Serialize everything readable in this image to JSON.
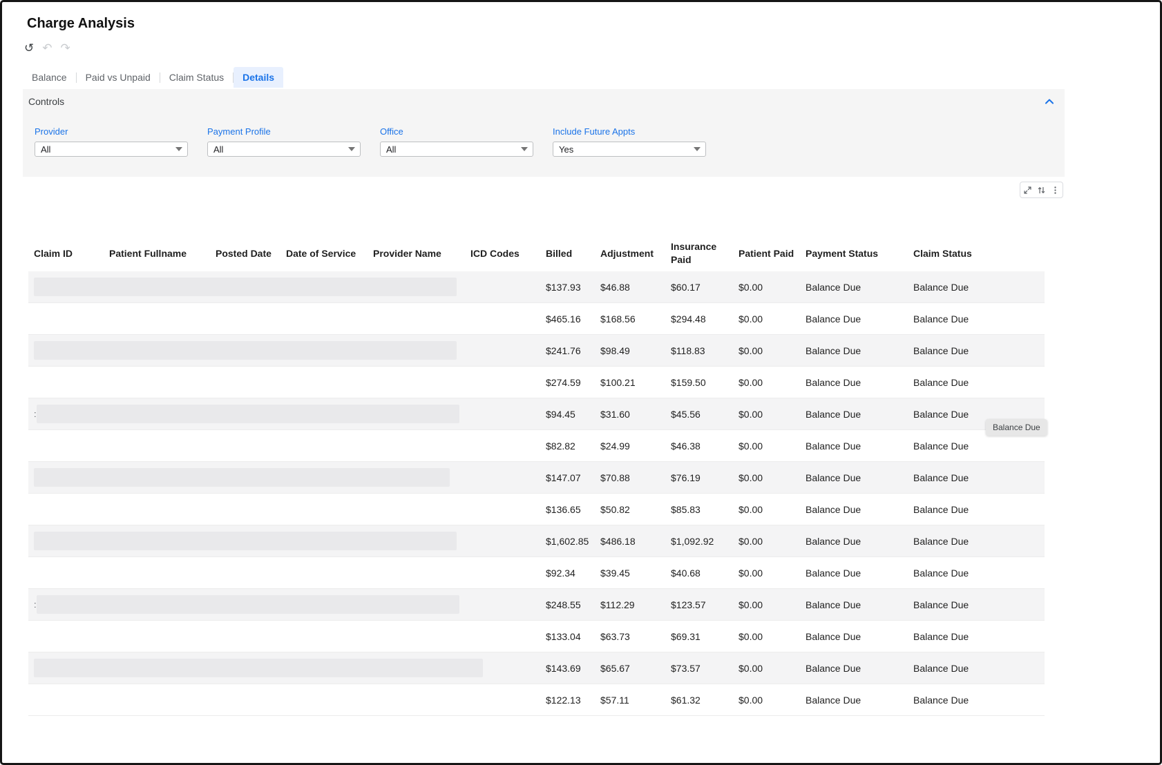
{
  "page": {
    "title": "Charge Analysis"
  },
  "colors": {
    "accent": "#1a73e8",
    "active_tab_bg": "#e8f0fe",
    "stripe": "#f4f4f5"
  },
  "history": {
    "reset_icon": "↺",
    "undo_icon": "↶",
    "redo_icon": "↷"
  },
  "tabs": [
    {
      "label": "Balance",
      "active": false
    },
    {
      "label": "Paid vs Unpaid",
      "active": false
    },
    {
      "label": "Claim Status",
      "active": false
    },
    {
      "label": "Details",
      "active": true
    }
  ],
  "controls": {
    "title": "Controls",
    "filters": [
      {
        "label": "Provider",
        "value": "All"
      },
      {
        "label": "Payment Profile",
        "value": "All"
      },
      {
        "label": "Office",
        "value": "All"
      },
      {
        "label": "Include Future Appts",
        "value": "Yes"
      }
    ]
  },
  "grid_toolbar": {
    "icons": [
      "expand-icon",
      "sort-icon",
      "kebab-menu-icon"
    ]
  },
  "tooltip": {
    "text": "Balance Due"
  },
  "table": {
    "columns": [
      "Claim ID",
      "Patient Fullname",
      "Posted Date",
      "Date of Service",
      "Provider Name",
      "ICD Codes",
      "Billed",
      "Adjustment",
      "Insurance Paid",
      "Patient Paid",
      "Payment Status",
      "Claim Status"
    ],
    "rows": [
      {
        "billed": "$137.93",
        "adjustment": "$46.88",
        "insurance_paid": "$60.17",
        "patient_paid": "$0.00",
        "payment_status": "Balance Due",
        "claim_status": "Balance Due"
      },
      {
        "billed": "$465.16",
        "adjustment": "$168.56",
        "insurance_paid": "$294.48",
        "patient_paid": "$0.00",
        "payment_status": "Balance Due",
        "claim_status": "Balance Due"
      },
      {
        "billed": "$241.76",
        "adjustment": "$98.49",
        "insurance_paid": "$118.83",
        "patient_paid": "$0.00",
        "payment_status": "Balance Due",
        "claim_status": "Balance Due"
      },
      {
        "billed": "$274.59",
        "adjustment": "$100.21",
        "insurance_paid": "$159.50",
        "patient_paid": "$0.00",
        "payment_status": "Balance Due",
        "claim_status": "Balance Due"
      },
      {
        "prefix": ":",
        "billed": "$94.45",
        "adjustment": "$31.60",
        "insurance_paid": "$45.56",
        "patient_paid": "$0.00",
        "payment_status": "Balance Due",
        "claim_status": "Balance Due"
      },
      {
        "billed": "$82.82",
        "adjustment": "$24.99",
        "insurance_paid": "$46.38",
        "patient_paid": "$0.00",
        "payment_status": "Balance Due",
        "claim_status": "Balance Due"
      },
      {
        "billed": "$147.07",
        "adjustment": "$70.88",
        "insurance_paid": "$76.19",
        "patient_paid": "$0.00",
        "payment_status": "Balance Due",
        "claim_status": "Balance Due"
      },
      {
        "billed": "$136.65",
        "adjustment": "$50.82",
        "insurance_paid": "$85.83",
        "patient_paid": "$0.00",
        "payment_status": "Balance Due",
        "claim_status": "Balance Due"
      },
      {
        "billed": "$1,602.85",
        "adjustment": "$486.18",
        "insurance_paid": "$1,092.92",
        "patient_paid": "$0.00",
        "payment_status": "Balance Due",
        "claim_status": "Balance Due"
      },
      {
        "billed": "$92.34",
        "adjustment": "$39.45",
        "insurance_paid": "$40.68",
        "patient_paid": "$0.00",
        "payment_status": "Balance Due",
        "claim_status": "Balance Due"
      },
      {
        "prefix": ":",
        "billed": "$248.55",
        "adjustment": "$112.29",
        "insurance_paid": "$123.57",
        "patient_paid": "$0.00",
        "payment_status": "Balance Due",
        "claim_status": "Balance Due"
      },
      {
        "billed": "$133.04",
        "adjustment": "$63.73",
        "insurance_paid": "$69.31",
        "patient_paid": "$0.00",
        "payment_status": "Balance Due",
        "claim_status": "Balance Due"
      },
      {
        "billed": "$143.69",
        "adjustment": "$65.67",
        "insurance_paid": "$73.57",
        "patient_paid": "$0.00",
        "payment_status": "Balance Due",
        "claim_status": "Balance Due"
      },
      {
        "billed": "$122.13",
        "adjustment": "$57.11",
        "insurance_paid": "$61.32",
        "patient_paid": "$0.00",
        "payment_status": "Balance Due",
        "claim_status": "Balance Due"
      }
    ]
  }
}
